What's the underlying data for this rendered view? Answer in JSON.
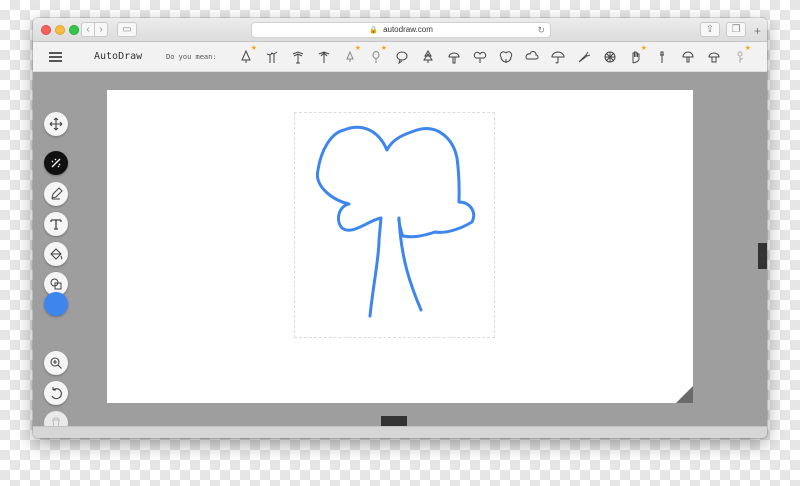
{
  "browser": {
    "address": "autodraw.com",
    "icons": [
      "back-icon",
      "forward-icon",
      "sidebar-icon",
      "lock-icon",
      "reload-icon",
      "share-icon",
      "tabs-icon",
      "plus-icon"
    ],
    "back_glyph": "‹",
    "forward_glyph": "›",
    "sidebar_glyph": "▭",
    "lock_glyph": "🔒",
    "reload_glyph": "↻",
    "share_glyph": "⇪",
    "tabs_glyph": "❐",
    "newtab_glyph": "+"
  },
  "app": {
    "title": "AutoDraw",
    "suggestion_label": "Do you mean:",
    "star_glyph": "★",
    "suggestions": [
      {
        "icon": "pine-tree-icon",
        "starred": true
      },
      {
        "icon": "palm-trees-icon",
        "starred": false
      },
      {
        "icon": "palm-tree-icon",
        "starred": false
      },
      {
        "icon": "palm-tree-2-icon",
        "starred": false
      },
      {
        "icon": "small-tree-icon",
        "starred": true
      },
      {
        "icon": "balloon-icon",
        "starred": true
      },
      {
        "icon": "speech-bubble-icon",
        "starred": false
      },
      {
        "icon": "fir-tree-icon",
        "starred": false
      },
      {
        "icon": "mushroom-icon",
        "starred": false
      },
      {
        "icon": "bubble-tree-icon",
        "starred": false
      },
      {
        "icon": "cloud-tree-icon",
        "starred": false
      },
      {
        "icon": "cloud-icon",
        "starred": false
      },
      {
        "icon": "umbrella-icon",
        "starred": false
      },
      {
        "icon": "carrot-icon",
        "starred": false
      },
      {
        "icon": "wheel-icon",
        "starred": false
      },
      {
        "icon": "hand-icon",
        "starred": true
      },
      {
        "icon": "lamp-post-icon",
        "starred": false
      },
      {
        "icon": "mushroom-2-icon",
        "starred": false
      },
      {
        "icon": "mushroom-3-icon",
        "starred": false
      },
      {
        "icon": "flower-icon",
        "starred": true
      }
    ],
    "tools": [
      {
        "name": "move-icon",
        "state": "normal"
      },
      {
        "name": "autodraw-icon",
        "state": "active"
      },
      {
        "name": "pencil-icon",
        "state": "normal"
      },
      {
        "name": "text-icon",
        "state": "normal"
      },
      {
        "name": "fill-icon",
        "state": "normal"
      },
      {
        "name": "shape-icon",
        "state": "normal"
      },
      {
        "name": "zoom-icon",
        "state": "normal"
      },
      {
        "name": "undo-icon",
        "state": "normal"
      },
      {
        "name": "delete-icon",
        "state": "disabled"
      }
    ],
    "stroke_color": "#3e86ee",
    "colors": {
      "window_bg": "#ffffff",
      "stage_bg": "#9e9e9e",
      "active_tool": "#111111"
    }
  }
}
